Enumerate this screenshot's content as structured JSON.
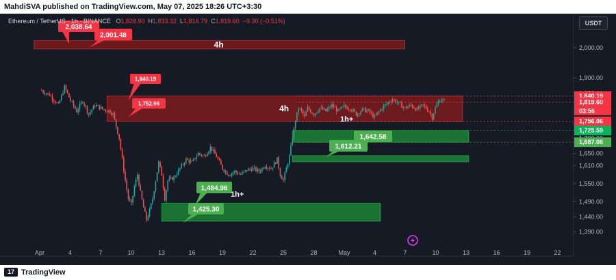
{
  "publisher_line": "MahdiSVA published on TradingView.com, May 07, 2025 18:26 UTC+3:30",
  "brand": "TradingView",
  "brand_mark": "17",
  "currency_button": "USDT",
  "header": {
    "symbol": "Ethereum / TetherUS · 1h · BINANCE",
    "o_label": "O",
    "o_value": "1,828.90",
    "h_label": "H",
    "h_value": "1,833.32",
    "l_label": "L",
    "l_value": "1,816.79",
    "c_label": "C",
    "c_value": "1,819.60",
    "change": "−9.30 (−0.51%)"
  },
  "colors": {
    "up": "#26a69a",
    "down": "#ef5350",
    "zone_red": "#b71c1c",
    "zone_green": "#1b8a36",
    "badge_red": "#f23645",
    "badge_green": "#4caf50",
    "price_green": "#0ab25b"
  },
  "chart_data": {
    "type": "candlestick",
    "symbol": "ETH/USDT",
    "timeframe": "1h",
    "ylim": [
      1365,
      2045
    ],
    "y_ticks": [
      2000,
      1900,
      1850,
      1800,
      1750,
      1700,
      1650,
      1610,
      1550,
      1490,
      1440,
      1390
    ],
    "x_ticks": [
      "Apr",
      "4",
      "7",
      "10",
      "13",
      "16",
      "19",
      "22",
      "25",
      "28",
      "May",
      "4",
      "7",
      "10",
      "13",
      "16",
      "19",
      "22"
    ],
    "price_path": [
      {
        "x": 0,
        "y": 1860
      },
      {
        "x": 3,
        "y": 1845
      },
      {
        "x": 6,
        "y": 1810
      },
      {
        "x": 8,
        "y": 1870
      },
      {
        "x": 10,
        "y": 1825
      },
      {
        "x": 12,
        "y": 1790
      },
      {
        "x": 14,
        "y": 1825
      },
      {
        "x": 16,
        "y": 1780
      },
      {
        "x": 18,
        "y": 1810
      },
      {
        "x": 21,
        "y": 1795
      },
      {
        "x": 23,
        "y": 1790
      },
      {
        "x": 24,
        "y": 1780
      },
      {
        "x": 26,
        "y": 1700
      },
      {
        "x": 27,
        "y": 1630
      },
      {
        "x": 28,
        "y": 1560
      },
      {
        "x": 29,
        "y": 1500
      },
      {
        "x": 30,
        "y": 1480
      },
      {
        "x": 31,
        "y": 1540
      },
      {
        "x": 32,
        "y": 1580
      },
      {
        "x": 33,
        "y": 1520
      },
      {
        "x": 34,
        "y": 1470
      },
      {
        "x": 35,
        "y": 1430
      },
      {
        "x": 36,
        "y": 1460
      },
      {
        "x": 37,
        "y": 1500
      },
      {
        "x": 38,
        "y": 1560
      },
      {
        "x": 39,
        "y": 1620
      },
      {
        "x": 40,
        "y": 1580
      },
      {
        "x": 41,
        "y": 1500
      },
      {
        "x": 42,
        "y": 1560
      },
      {
        "x": 44,
        "y": 1570
      },
      {
        "x": 46,
        "y": 1600
      },
      {
        "x": 48,
        "y": 1630
      },
      {
        "x": 50,
        "y": 1620
      },
      {
        "x": 52,
        "y": 1650
      },
      {
        "x": 54,
        "y": 1640
      },
      {
        "x": 56,
        "y": 1670
      },
      {
        "x": 58,
        "y": 1640
      },
      {
        "x": 60,
        "y": 1600
      },
      {
        "x": 62,
        "y": 1580
      },
      {
        "x": 64,
        "y": 1590
      },
      {
        "x": 66,
        "y": 1580
      },
      {
        "x": 68,
        "y": 1595
      },
      {
        "x": 70,
        "y": 1600
      },
      {
        "x": 72,
        "y": 1590
      },
      {
        "x": 74,
        "y": 1610
      },
      {
        "x": 76,
        "y": 1600
      },
      {
        "x": 78,
        "y": 1630
      },
      {
        "x": 79,
        "y": 1580
      },
      {
        "x": 80,
        "y": 1560
      },
      {
        "x": 81,
        "y": 1600
      },
      {
        "x": 82,
        "y": 1640
      },
      {
        "x": 83,
        "y": 1700
      },
      {
        "x": 84,
        "y": 1760
      },
      {
        "x": 85,
        "y": 1800
      },
      {
        "x": 86,
        "y": 1790
      },
      {
        "x": 87,
        "y": 1770
      },
      {
        "x": 88,
        "y": 1800
      },
      {
        "x": 90,
        "y": 1780
      },
      {
        "x": 92,
        "y": 1800
      },
      {
        "x": 94,
        "y": 1790
      },
      {
        "x": 96,
        "y": 1810
      },
      {
        "x": 98,
        "y": 1790
      },
      {
        "x": 100,
        "y": 1805
      },
      {
        "x": 102,
        "y": 1800
      },
      {
        "x": 104,
        "y": 1780
      },
      {
        "x": 106,
        "y": 1795
      },
      {
        "x": 108,
        "y": 1790
      },
      {
        "x": 110,
        "y": 1770
      },
      {
        "x": 112,
        "y": 1795
      },
      {
        "x": 114,
        "y": 1815
      },
      {
        "x": 116,
        "y": 1830
      },
      {
        "x": 118,
        "y": 1815
      },
      {
        "x": 120,
        "y": 1800
      },
      {
        "x": 122,
        "y": 1810
      },
      {
        "x": 124,
        "y": 1795
      },
      {
        "x": 126,
        "y": 1810
      },
      {
        "x": 128,
        "y": 1790
      },
      {
        "x": 129,
        "y": 1770
      },
      {
        "x": 130,
        "y": 1800
      },
      {
        "x": 131,
        "y": 1820
      },
      {
        "x": 132,
        "y": 1830
      },
      {
        "x": 133,
        "y": 1820
      }
    ],
    "zones": [
      {
        "type": "supply",
        "label": "4h",
        "y_top": 2024,
        "y_bottom": 1996,
        "x_start": -2,
        "x_end": 120
      },
      {
        "type": "supply",
        "label": "4h",
        "y_top": 1840.19,
        "y_bottom": 1756.06,
        "x_start": 22,
        "x_end": 139
      },
      {
        "type": "demand",
        "label": "",
        "y_top": 1725.59,
        "y_bottom": 1687.08,
        "x_start": 83,
        "x_end": 141
      },
      {
        "type": "demand",
        "label": "",
        "y_top": 1642.58,
        "y_bottom": 1622,
        "x_start": 83,
        "x_end": 141
      },
      {
        "type": "demand",
        "label": "",
        "y_top": 1484.96,
        "y_bottom": 1425.3,
        "x_start": 40,
        "x_end": 112
      }
    ],
    "annotations": [
      {
        "text": "2,038.64",
        "color": "red",
        "price": 2038.64,
        "small": false
      },
      {
        "text": "2,001.48",
        "color": "red",
        "price": 2001.48,
        "small": false
      },
      {
        "text": "1,840.19",
        "color": "red",
        "price": 1840.19,
        "small": true
      },
      {
        "text": "1,752.96",
        "color": "red",
        "price": 1752.96,
        "small": true
      },
      {
        "text": "1,642.58",
        "color": "green",
        "price": 1642.58,
        "small": false
      },
      {
        "text": "1,612.21",
        "color": "green",
        "price": 1612.21,
        "small": false
      },
      {
        "text": "1,484.96",
        "color": "green",
        "price": 1484.96,
        "small": false
      },
      {
        "text": "1,425.30",
        "color": "green",
        "price": 1425.3,
        "small": false
      }
    ],
    "text_labels": [
      "1h+",
      "1h+"
    ],
    "price_badges": [
      {
        "price": 1840.19,
        "text": "1,840.19",
        "color": "red"
      },
      {
        "price": 1819.6,
        "text": "1,819.60",
        "color": "red"
      },
      {
        "price": 1756.06,
        "text": "1,756.06",
        "color": "red"
      },
      {
        "price": 1725.59,
        "text": "1,725.59",
        "color": "green"
      },
      {
        "price": 1687.08,
        "text": "1,687.08",
        "color": "green"
      }
    ],
    "countdown": "03:56",
    "last_price": 1819.6
  }
}
